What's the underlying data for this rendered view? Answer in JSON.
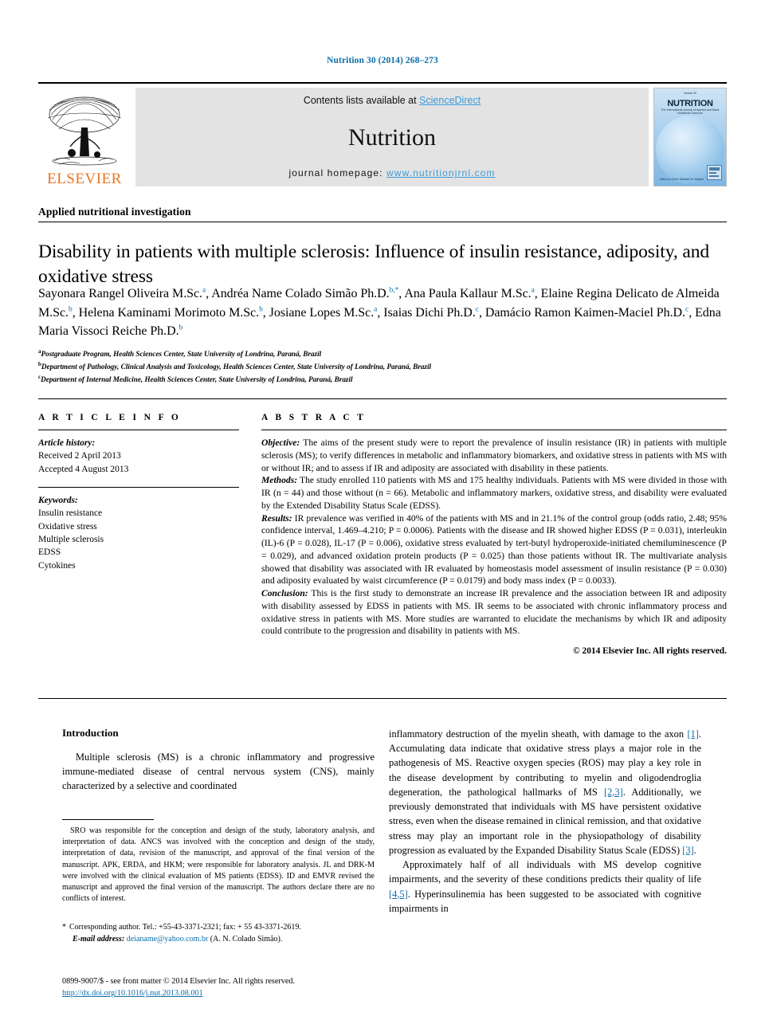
{
  "running_head": "Nutrition 30 (2014) 268–273",
  "masthead": {
    "publisher": "ELSEVIER",
    "contents_prefix": "Contents lists available at ",
    "contents_link": "ScienceDirect",
    "journal_name": "Nutrition",
    "homepage_prefix": "journal homepage: ",
    "homepage_url": "www.nutritionjrnl.com",
    "cover": {
      "title": "NUTRITION",
      "volume_line": "Volume 30",
      "subtitle": "The International Journal of Applied and Basic Nutritional Sciences",
      "footer": "Editor-in-Chief: Michael M. Meguid"
    }
  },
  "section_label": "Applied nutritional investigation",
  "title": "Disability in patients with multiple sclerosis: Influence of insulin resistance, adiposity, and oxidative stress",
  "authors_html": "Sayonara Rangel Oliveira M.Sc.<sup>a</sup>, Andréa Name Colado Simão Ph.D.<sup>b,*</sup>, Ana Paula Kallaur M.Sc.<sup>a</sup>, Elaine Regina Delicato de Almeida M.Sc.<sup>b</sup>, Helena Kaminami Morimoto M.Sc.<sup>b</sup>, Josiane Lopes M.Sc.<sup>a</sup>, Isaias Dichi Ph.D.<sup>c</sup>, Damácio Ramon Kaimen-Maciel Ph.D.<sup>c</sup>, Edna Maria Vissoci Reiche Ph.D.<sup>b</sup>",
  "affiliations": [
    {
      "marker": "a",
      "text": "Postgraduate Program, Health Sciences Center, State University of Londrina, Paraná, Brazil"
    },
    {
      "marker": "b",
      "text": "Department of Pathology, Clinical Analysis and Toxicology, Health Sciences Center, State University of Londrina, Paraná, Brazil"
    },
    {
      "marker": "c",
      "text": "Department of Internal Medicine, Health Sciences Center, State University of Londrina, Paraná, Brazil"
    }
  ],
  "article_info": {
    "heading": "A R T I C L E  I N F O",
    "history_label": "Article history:",
    "history": [
      "Received 2 April 2013",
      "Accepted 4 August 2013"
    ],
    "keywords_label": "Keywords:",
    "keywords": [
      "Insulin resistance",
      "Oxidative stress",
      "Multiple sclerosis",
      "EDSS",
      "Cytokines"
    ]
  },
  "abstract": {
    "heading": "A B S T R A C T",
    "objective_label": "Objective:",
    "objective_text": " The aims of the present study were to report the prevalence of insulin resistance (IR) in patients with multiple sclerosis (MS); to verify differences in metabolic and inflammatory biomarkers, and oxidative stress in patients with MS with or without IR; and to assess if IR and adiposity are associated with disability in these patients.",
    "methods_label": "Methods:",
    "methods_text": " The study enrolled 110 patients with MS and 175 healthy individuals. Patients with MS were divided in those with IR (n = 44) and those without (n = 66). Metabolic and inflammatory markers, oxidative stress, and disability were evaluated by the Extended Disability Status Scale (EDSS).",
    "results_label": "Results:",
    "results_text": " IR prevalence was verified in 40% of the patients with MS and in 21.1% of the control group (odds ratio, 2.48; 95% confidence interval, 1.469–4.210; P = 0.0006). Patients with the disease and IR showed higher EDSS (P = 0.031), interleukin (IL)-6 (P = 0.028), IL-17 (P = 0.006), oxidative stress evaluated by tert-butyl hydroperoxide-initiated chemiluminescence (P = 0.029), and advanced oxidation protein products (P = 0.025) than those patients without IR. The multivariate analysis showed that disability was associated with IR evaluated by homeostasis model assessment of insulin resistance (P = 0.030) and adiposity evaluated by waist circumference (P = 0.0179) and body mass index (P = 0.0033).",
    "conclusion_label": "Conclusion:",
    "conclusion_text": " This is the first study to demonstrate an increase IR prevalence and the association between IR and adiposity with disability assessed by EDSS in patients with MS. IR seems to be associated with chronic inflammatory process and oxidative stress in patients with MS. More studies are warranted to elucidate the mechanisms by which IR and adiposity could contribute to the progression and disability in patients with MS.",
    "copyright": "© 2014 Elsevier Inc. All rights reserved."
  },
  "body": {
    "intro_heading": "Introduction",
    "left_para_1": "Multiple sclerosis (MS) is a chronic inflammatory and progressive immune-mediated disease of central nervous system (CNS), mainly characterized by a selective and coordinated",
    "right_para_1_a": "inflammatory destruction of the myelin sheath, with damage to the axon ",
    "right_ref_1": "[1]",
    "right_para_1_b": ". Accumulating data indicate that oxidative stress plays a major role in the pathogenesis of MS. Reactive oxygen species (ROS) may play a key role in the disease development by contributing to myelin and oligodendroglia degeneration, the pathological hallmarks of MS ",
    "right_ref_2": "[2,3]",
    "right_para_1_c": ". Additionally, we previously demonstrated that individuals with MS have persistent oxidative stress, even when the disease remained in clinical remission, and that oxidative stress may play an important role in the physiopathology of disability progression as evaluated by the Expanded Disability Status Scale (EDSS) ",
    "right_ref_3": "[3]",
    "right_para_1_d": ".",
    "right_para_2_a": "Approximately half of all individuals with MS develop cognitive impairments, and the severity of these conditions predicts their quality of life ",
    "right_ref_4": "[4,5]",
    "right_para_2_b": ". Hyperinsulinemia has been suggested to be associated with cognitive impairments in"
  },
  "footnotes": {
    "contributions": "SRO was responsible for the conception and design of the study, laboratory analysis, and interpretation of data. ANCS was involved with the conception and design of the study, interpretation of data, revision of the manuscript, and approval of the final version of the manuscript. APK, ERDA, and HKM; were responsible for laboratory analysis. JL and DRK-M were involved with the clinical evaluation of MS patients (EDSS). ID and EMVR revised the manuscript and approved the final version of the manuscript. The authors declare there are no conflicts of interest.",
    "corresponding_star": "*",
    "corresponding_text": "Corresponding author. Tel.: +55-43-3371-2321; fax: + 55 43-3371-2619.",
    "email_label": "E-mail address:",
    "email": "deianame@yahoo.com.br",
    "email_owner": "(A. N. Colado Simão).",
    "front_matter": "0899-9007/$ - see front matter © 2014 Elsevier Inc. All rights reserved.",
    "doi": "http://dx.doi.org/10.1016/j.nut.2013.08.001"
  }
}
